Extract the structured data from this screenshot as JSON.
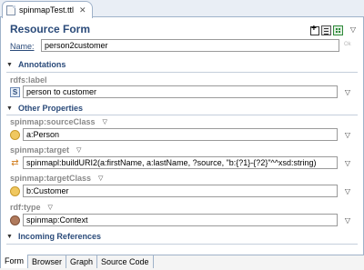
{
  "editor": {
    "tab_title": "spinmapTest.ttl",
    "close_glyph": "✕"
  },
  "form": {
    "title": "Resource Form",
    "name_label": "Name:",
    "name_value": "person2customer",
    "ok_label": "Ok",
    "tools": [
      "add-widget-icon",
      "list-view-icon",
      "grid-view-icon"
    ],
    "menu_glyph": "▽"
  },
  "sections": {
    "annotations": "Annotations",
    "other_properties": "Other Properties",
    "incoming_references": "Incoming References"
  },
  "properties": {
    "rdfs_label": {
      "name": "rdfs:label",
      "value": "person to customer",
      "icon": "literal-s-icon"
    },
    "source_class": {
      "name": "spinmap:sourceClass",
      "value": "a:Person",
      "icon": "class-icon"
    },
    "target": {
      "name": "spinmap:target",
      "value": "spinmapl:buildURI2(a:firstName, a:lastName, ?source, \"b:{?1}-{?2}\"^^xsd:string)",
      "icon": "function-call-icon"
    },
    "target_class": {
      "name": "spinmap:targetClass",
      "value": "b:Customer",
      "icon": "class-icon"
    },
    "rdf_type": {
      "name": "rdf:type",
      "value": "spinmap:Context",
      "icon": "instance-icon"
    }
  },
  "section_glyph": "▼",
  "menu_glyph": "▽",
  "bottom_tabs": [
    "Form",
    "Browser",
    "Graph",
    "Source Code"
  ],
  "colors": {
    "section_title": "#2b4b7a",
    "property_label": "#8a8a8a",
    "class_icon": "#f0c860",
    "instance_icon": "#b07a5c",
    "function_icon": "#d07b1a"
  }
}
